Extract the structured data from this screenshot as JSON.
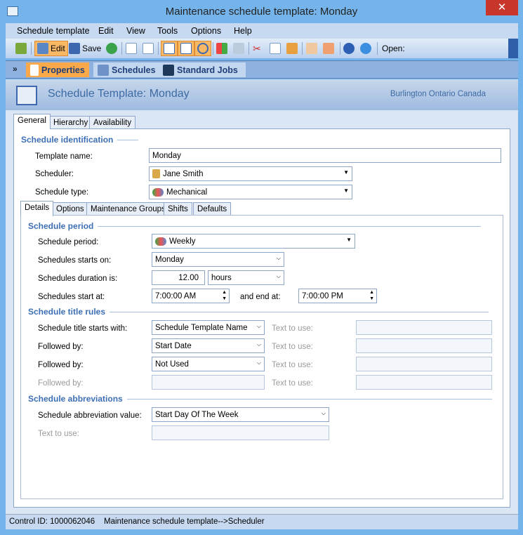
{
  "window": {
    "title": "Maintenance schedule template: Monday",
    "close": "✕"
  },
  "menu": [
    "Schedule template",
    "Edit",
    "View",
    "Tools",
    "Options",
    "Help"
  ],
  "toolbar": {
    "edit": "Edit",
    "save": "Save",
    "open": "Open:"
  },
  "nav": {
    "properties": "Properties",
    "schedules": "Schedules",
    "standard_jobs": "Standard Jobs"
  },
  "header": {
    "title": "Schedule Template: Monday",
    "location": "Burlington Ontario Canada"
  },
  "tabs": [
    "General",
    "Hierarchy",
    "Availability"
  ],
  "ident": {
    "section": "Schedule identification",
    "template_name_label": "Template name:",
    "template_name": "Monday",
    "scheduler_label": "Scheduler:",
    "scheduler": "Jane Smith",
    "type_label": "Schedule type:",
    "type": "Mechanical"
  },
  "subtabs": [
    "Details",
    "Options",
    "Maintenance Groups",
    "Shifts",
    "Defaults"
  ],
  "period": {
    "section": "Schedule period",
    "period_label": "Schedule period:",
    "period": "Weekly",
    "starts_on_label": "Schedules starts on:",
    "starts_on": "Monday",
    "duration_label": "Schedules duration is:",
    "duration": "12.00",
    "duration_unit": "hours",
    "start_at_label": "Schedules start at:",
    "start_at": "7:00:00 AM",
    "end_at_label": "and end at:",
    "end_at": "7:00:00 PM"
  },
  "title_rules": {
    "section": "Schedule title rules",
    "rows": [
      {
        "label": "Schedule title starts with:",
        "value": "Schedule Template Name",
        "text_label": "Text to use:",
        "text": "",
        "disabled": false
      },
      {
        "label": "Followed by:",
        "value": "Start Date",
        "text_label": "Text to use:",
        "text": "",
        "disabled": false
      },
      {
        "label": "Followed by:",
        "value": "Not Used",
        "text_label": "Text to use:",
        "text": "",
        "disabled": false
      },
      {
        "label": "Followed by:",
        "value": "",
        "text_label": "Text to use:",
        "text": "",
        "disabled": true
      }
    ]
  },
  "abbrev": {
    "section": "Schedule abbreviations",
    "value_label": "Schedule abbreviation value:",
    "value": "Start Day Of The Week",
    "text_label": "Text to use:",
    "text": ""
  },
  "status": {
    "control_id": "Control ID: 1000062046",
    "path": "Maintenance schedule template-->Scheduler"
  }
}
